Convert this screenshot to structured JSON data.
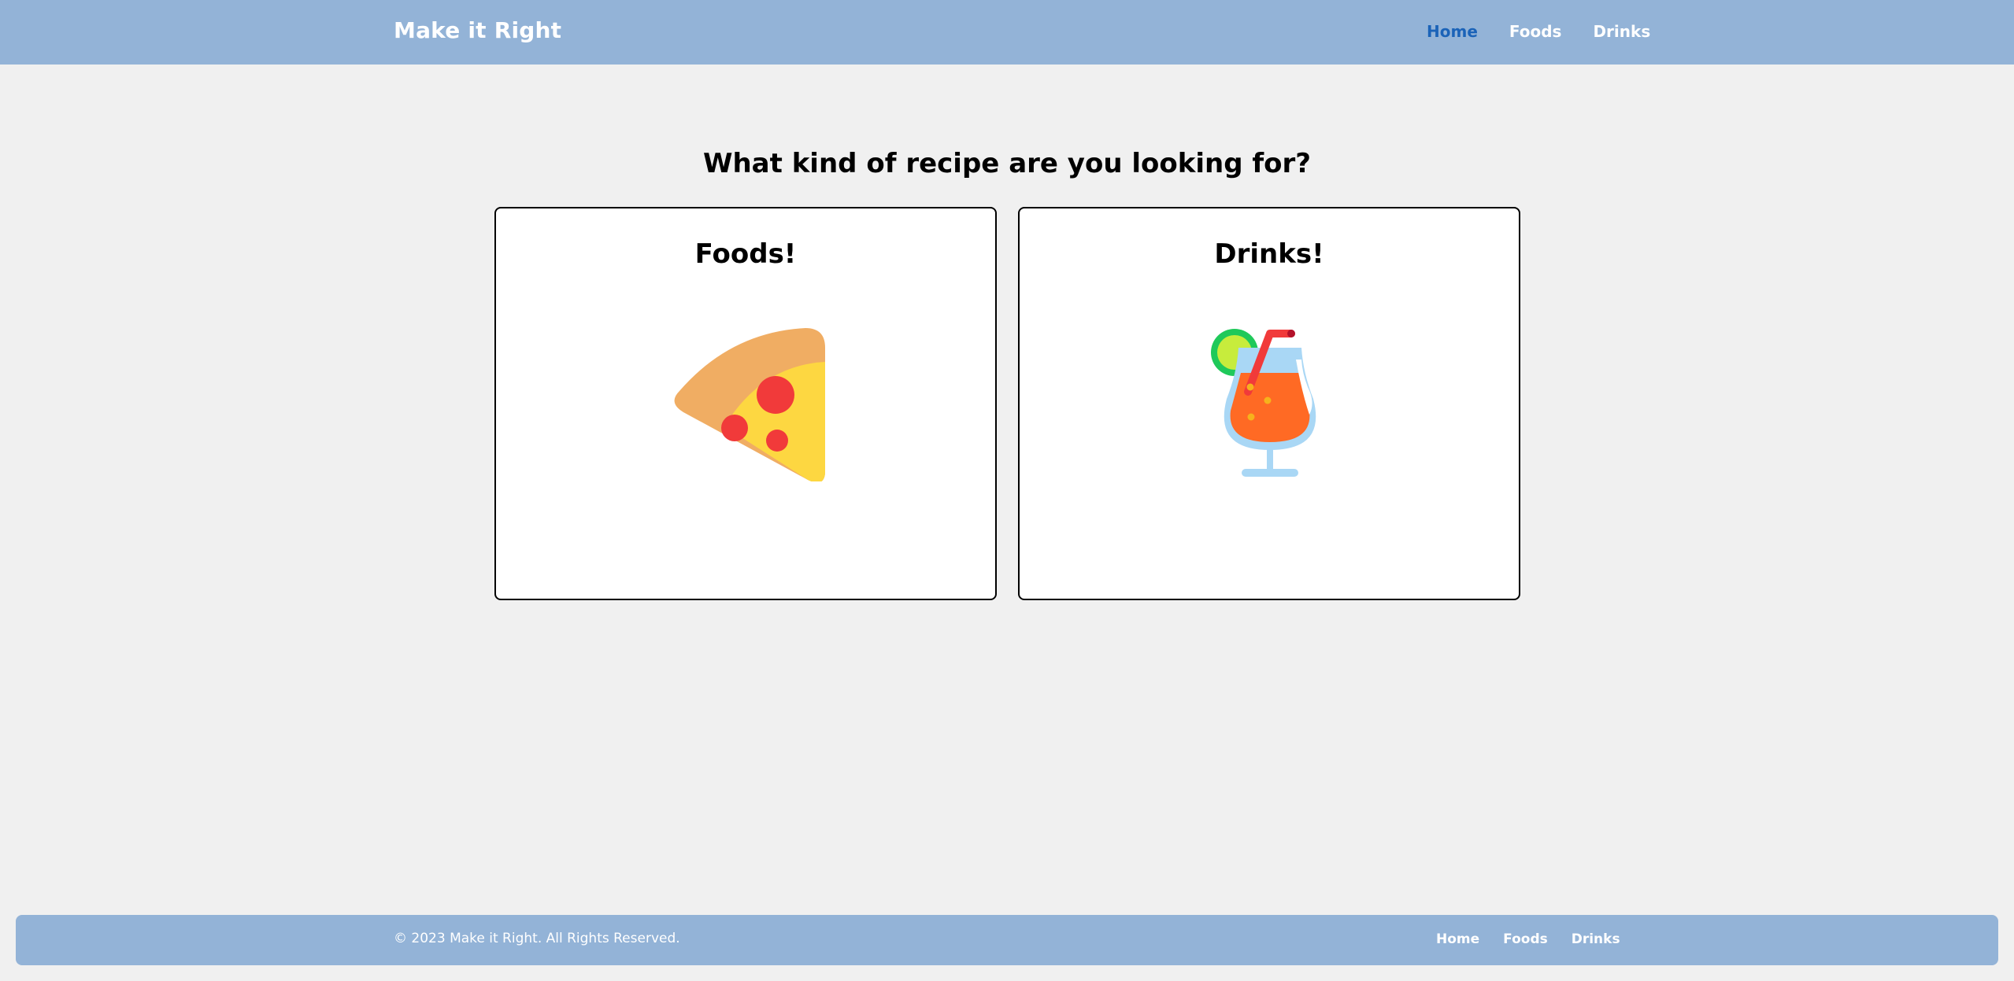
{
  "navbar": {
    "brand": "Make it Right",
    "links": [
      {
        "label": "Home",
        "active": true
      },
      {
        "label": "Foods",
        "active": false
      },
      {
        "label": "Drinks",
        "active": false
      }
    ]
  },
  "main": {
    "heading": "What kind of recipe are you looking for?",
    "cards": [
      {
        "title": "Foods!",
        "icon": "pizza-slice-icon"
      },
      {
        "title": "Drinks!",
        "icon": "cocktail-icon"
      }
    ]
  },
  "footer": {
    "copyright": "© 2023 Make it Right. All Rights Reserved.",
    "links": [
      "Home",
      "Foods",
      "Drinks"
    ]
  },
  "colors": {
    "navbar_bg": "#93b3d7",
    "page_bg": "#f0f0f0",
    "active_link": "#1b63b8"
  }
}
